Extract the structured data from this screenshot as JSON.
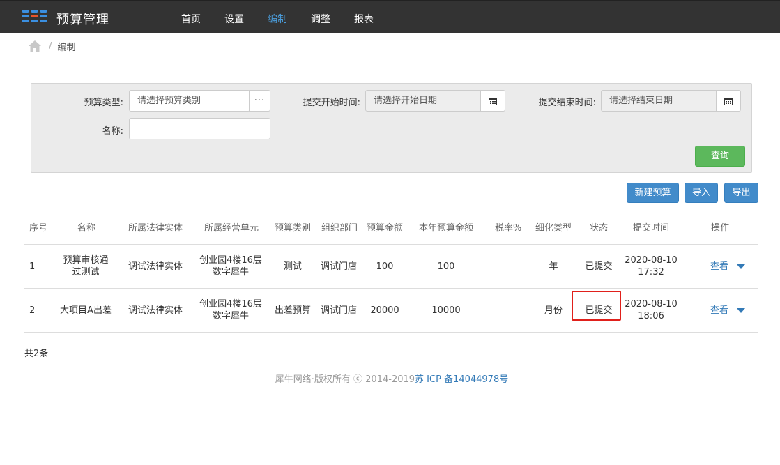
{
  "app": {
    "title": "预算管理"
  },
  "nav": {
    "items": [
      "首页",
      "设置",
      "编制",
      "调整",
      "报表"
    ],
    "active_index": 2
  },
  "breadcrumb": {
    "current": "编制"
  },
  "search": {
    "budget_type_label": "预算类型:",
    "budget_type_placeholder": "请选择预算类别",
    "budget_type_more": "···",
    "start_label": "提交开始时间:",
    "start_placeholder": "请选择开始日期",
    "end_label": "提交结束时间:",
    "end_placeholder": "请选择结束日期",
    "name_label": "名称:",
    "name_value": "",
    "query_button": "查询"
  },
  "toolbar": {
    "new_budget": "新建预算",
    "import": "导入",
    "export": "导出"
  },
  "table": {
    "headers": [
      "序号",
      "名称",
      "所属法律实体",
      "所属经营单元",
      "预算类别",
      "组织部门",
      "预算金额",
      "本年预算金额",
      "税率%",
      "细化类型",
      "状态",
      "提交时间",
      "操作"
    ],
    "rows": [
      {
        "index": "1",
        "name_line1": "预算审核通",
        "name_line2": "过测试",
        "legal_entity": "调试法律实体",
        "unit_line1": "创业园4楼16层",
        "unit_line2": "数字犀牛",
        "category": "测试",
        "department": "调试门店",
        "amount": "100",
        "year_amount": "100",
        "tax_rate": "",
        "detail_type": "年",
        "status": "已提交",
        "date": "2020-08-10",
        "time": "17:32",
        "action": "查看"
      },
      {
        "index": "2",
        "name_line1": "大项目A出差",
        "name_line2": "",
        "legal_entity": "调试法律实体",
        "unit_line1": "创业园4楼16层",
        "unit_line2": "数字犀牛",
        "category": "出差预算",
        "department": "调试门店",
        "amount": "20000",
        "year_amount": "10000",
        "tax_rate": "",
        "detail_type": "月份",
        "status": "已提交",
        "date": "2020-08-10",
        "time": "18:06",
        "action": "查看"
      }
    ]
  },
  "summary": {
    "total": "共2条"
  },
  "footer": {
    "copyright": "犀牛网络·版权所有 ⓒ 2014-2019",
    "icp": "苏 ICP 备14044978号"
  },
  "colors": {
    "topbar": "#333333",
    "nav_active": "#4a9bd8",
    "primary": "#428bca",
    "success": "#5cb85c",
    "highlight": "#e0201b",
    "link": "#337ab7"
  }
}
